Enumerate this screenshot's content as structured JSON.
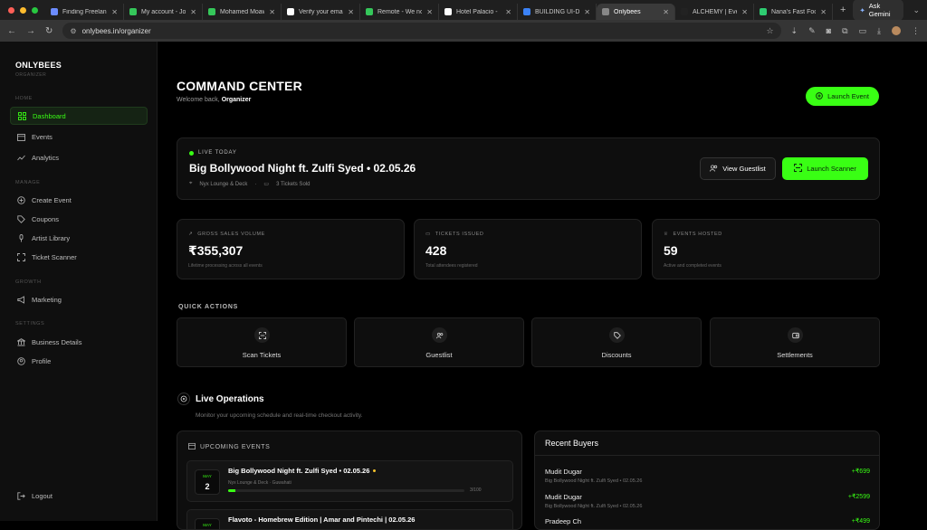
{
  "browser": {
    "tabs": [
      {
        "title": "Finding Freelan",
        "color": "#6c8cff"
      },
      {
        "title": "My account - Jo",
        "color": "#35c75a"
      },
      {
        "title": "Mohamed Moaw",
        "color": "#35c75a"
      },
      {
        "title": "Verify your ema",
        "color": "#ffffff"
      },
      {
        "title": "Remote - We no",
        "color": "#35c75a"
      },
      {
        "title": "Hotel Palacio - ",
        "color": "#ffffff"
      },
      {
        "title": "BUILDING UI-DI",
        "color": "#3b82f6"
      },
      {
        "title": "Onlybees",
        "color": "#888888"
      },
      {
        "title": "ALCHEMY | Eve",
        "color": "#222222"
      },
      {
        "title": "Nana's Fast Foo",
        "color": "#2ecc71"
      }
    ],
    "active_tab_index": 7,
    "ask_label": "Ask Gemini",
    "url": "onlybees.in/organizer"
  },
  "sidebar": {
    "brand": "ONLYBEES",
    "brand_sub": "ORGANIZER",
    "sections": {
      "home": "HOME",
      "manage": "MANAGE",
      "growth": "GROWTH",
      "settings": "SETTINGS"
    },
    "items": {
      "dashboard": "Dashboard",
      "events": "Events",
      "analytics": "Analytics",
      "create_event": "Create Event",
      "coupons": "Coupons",
      "artist_library": "Artist Library",
      "ticket_scanner": "Ticket Scanner",
      "marketing": "Marketing",
      "business_details": "Business Details",
      "profile": "Profile",
      "logout": "Logout"
    }
  },
  "header": {
    "title": "COMMAND CENTER",
    "welcome": "Welcome back,",
    "user": "Organizer",
    "launch_label": "Launch Event"
  },
  "live": {
    "tag": "LIVE TODAY",
    "title": "Big Bollywood Night ft. Zulfi Syed • 02.05.26",
    "venue": "Nyx Lounge & Deck",
    "sold": "3 Tickets Sold",
    "guestlist_label": "View Guestlist",
    "scanner_label": "Launch Scanner"
  },
  "stats": [
    {
      "label": "GROSS SALES VOLUME",
      "value": "₹355,307",
      "sub": "Lifetime processing across all events"
    },
    {
      "label": "TICKETS ISSUED",
      "value": "428",
      "sub": "Total attendees registered"
    },
    {
      "label": "EVENTS HOSTED",
      "value": "59",
      "sub": "Active and completed events"
    }
  ],
  "quick_actions": {
    "title": "QUICK ACTIONS",
    "items": [
      "Scan Tickets",
      "Guestlist",
      "Discounts",
      "Settlements"
    ]
  },
  "live_ops": {
    "title": "Live Operations",
    "subtitle": "Monitor your upcoming schedule and real-time checkout activity."
  },
  "upcoming": {
    "title": "UPCOMING EVENTS",
    "events": [
      {
        "month": "MAY",
        "day": "2",
        "title": "Big Bollywood Night ft. Zulfi Syed • 02.05.26",
        "location": "Nyx Lounge & Deck · Guwahati",
        "count": "3/100",
        "progress": 0.03
      },
      {
        "month": "MAY",
        "day": "",
        "title": "Flavoto - Homebrew Edition | Amar and Pintechi | 02.05.26",
        "location": "",
        "count": "",
        "progress": 0
      }
    ]
  },
  "recent": {
    "title": "Recent Buyers",
    "buyers": [
      {
        "name": "Mudit Dugar",
        "event": "Big Bollywood Night ft. Zulfi Syed • 02.05.26",
        "amount": "+₹699"
      },
      {
        "name": "Mudit Dugar",
        "event": "Big Bollywood Night ft. Zulfi Syed • 02.05.26",
        "amount": "+₹2599"
      },
      {
        "name": "Pradeep Ch",
        "event": "",
        "amount": "+₹499"
      }
    ]
  },
  "colors": {
    "accent": "#39ff14",
    "background": "#000000",
    "card": "#0e0e0e"
  }
}
